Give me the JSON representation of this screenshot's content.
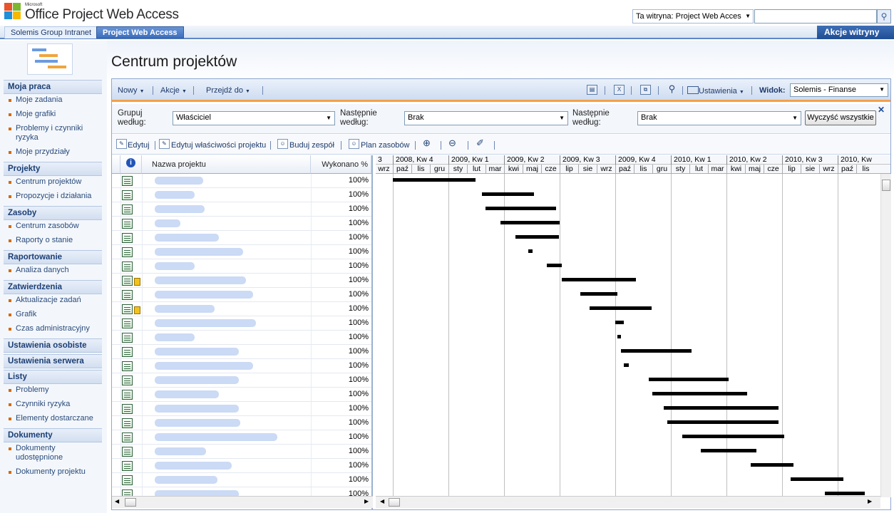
{
  "header": {
    "brand_small": "Microsoft",
    "brand": "Office Project Web Access",
    "search_scope": "Ta witryna: Project Web Acces",
    "search_value": "",
    "site_actions": "Akcje witryny"
  },
  "tabs": [
    {
      "label": "Solemis Group Intranet"
    },
    {
      "label": "Project Web Access"
    }
  ],
  "page": {
    "title": "Centrum projektów"
  },
  "nav": {
    "sections": [
      {
        "title": "Moja praca",
        "items": [
          "Moje zadania",
          "Moje grafiki",
          "Problemy i czynniki ryzyka",
          "Moje przydziały"
        ]
      },
      {
        "title": "Projekty",
        "items": [
          "Centrum projektów",
          "Propozycje i działania"
        ]
      },
      {
        "title": "Zasoby",
        "items": [
          "Centrum zasobów",
          "Raporty o stanie"
        ]
      },
      {
        "title": "Raportowanie",
        "items": [
          "Analiza danych"
        ]
      },
      {
        "title": "Zatwierdzenia",
        "items": [
          "Aktualizacje zadań",
          "Grafik",
          "Czas administracyjny"
        ]
      },
      {
        "title": "Ustawienia osobiste",
        "items": []
      },
      {
        "title": "Ustawienia serwera",
        "items": []
      },
      {
        "title": "Listy",
        "items": [
          "Problemy",
          "Czynniki ryzyka",
          "Elementy dostarczane"
        ]
      },
      {
        "title": "Dokumenty",
        "items": [
          "Dokumenty udostępnione",
          "Dokumenty projektu"
        ]
      }
    ]
  },
  "toolbar": {
    "new": "Nowy",
    "actions": "Akcje",
    "goto": "Przejdź do",
    "settings": "Ustawienia",
    "view_label": "Widok:",
    "view_value": "Solemis - Finanse"
  },
  "grouping": {
    "group_by_label": "Grupuj według:",
    "group_by_value": "Właściciel",
    "then_by_label_1": "Następnie według:",
    "then_by_value_1": "Brak",
    "then_by_label_2": "Następnie według:",
    "then_by_value_2": "Brak",
    "clear_all": "Wyczyść wszystkie"
  },
  "actions_bar": {
    "edit": "Edytuj",
    "edit_props": "Edytuj właściwości projektu",
    "build_team": "Buduj zespół",
    "resource_plan": "Plan zasobów"
  },
  "grid": {
    "headers": {
      "info": "i",
      "name": "Nazwa projektu",
      "percent": "Wykonano %"
    },
    "rows": [
      {
        "percent": "100%",
        "lock": false,
        "name_w": 68
      },
      {
        "percent": "100%",
        "lock": false,
        "name_w": 56
      },
      {
        "percent": "100%",
        "lock": false,
        "name_w": 70
      },
      {
        "percent": "100%",
        "lock": false,
        "name_w": 36
      },
      {
        "percent": "100%",
        "lock": false,
        "name_w": 90
      },
      {
        "percent": "100%",
        "lock": false,
        "name_w": 124
      },
      {
        "percent": "100%",
        "lock": false,
        "name_w": 56
      },
      {
        "percent": "100%",
        "lock": true,
        "name_w": 128
      },
      {
        "percent": "100%",
        "lock": false,
        "name_w": 138
      },
      {
        "percent": "100%",
        "lock": true,
        "name_w": 84
      },
      {
        "percent": "100%",
        "lock": false,
        "name_w": 142
      },
      {
        "percent": "100%",
        "lock": false,
        "name_w": 56
      },
      {
        "percent": "100%",
        "lock": false,
        "name_w": 118
      },
      {
        "percent": "100%",
        "lock": false,
        "name_w": 138
      },
      {
        "percent": "100%",
        "lock": false,
        "name_w": 118
      },
      {
        "percent": "100%",
        "lock": false,
        "name_w": 90
      },
      {
        "percent": "100%",
        "lock": false,
        "name_w": 118
      },
      {
        "percent": "100%",
        "lock": false,
        "name_w": 120
      },
      {
        "percent": "100%",
        "lock": false,
        "name_w": 172
      },
      {
        "percent": "100%",
        "lock": false,
        "name_w": 72
      },
      {
        "percent": "100%",
        "lock": false,
        "name_w": 108
      },
      {
        "percent": "100%",
        "lock": false,
        "name_w": 88
      },
      {
        "percent": "100%",
        "lock": false,
        "name_w": 118
      }
    ]
  },
  "gantt": {
    "quarters": [
      "3",
      "2008, Kw 4",
      "2009, Kw 1",
      "2009, Kw 2",
      "2009, Kw 3",
      "2009, Kw 4",
      "2010, Kw 1",
      "2010, Kw 2",
      "2010, Kw 3",
      "2010, Kw"
    ],
    "months": [
      "wrz",
      "paź",
      "lis",
      "gru",
      "sty",
      "lut",
      "mar",
      "kwi",
      "maj",
      "cze",
      "lip",
      "sie",
      "wrz",
      "paź",
      "lis",
      "gru",
      "sty",
      "lut",
      "mar",
      "kwi",
      "maj",
      "cze",
      "lip",
      "sie",
      "wrz",
      "paź",
      "lis"
    ],
    "bars": [
      {
        "start": "2008-10-01",
        "end": "2009-02-15"
      },
      {
        "start": "2009-02-25",
        "end": "2009-05-20"
      },
      {
        "start": "2009-03-01",
        "end": "2009-06-25"
      },
      {
        "start": "2009-03-25",
        "end": "2009-07-01"
      },
      {
        "start": "2009-04-20",
        "end": "2009-06-30"
      },
      {
        "start": "2009-05-10",
        "end": "2009-05-17"
      },
      {
        "start": "2009-06-10",
        "end": "2009-07-05"
      },
      {
        "start": "2009-07-05",
        "end": "2009-11-05"
      },
      {
        "start": "2009-08-05",
        "end": "2009-10-05"
      },
      {
        "start": "2009-08-20",
        "end": "2009-11-30"
      },
      {
        "start": "2009-10-01",
        "end": "2009-10-15"
      },
      {
        "start": "2009-10-05",
        "end": "2009-10-10"
      },
      {
        "start": "2009-10-10",
        "end": "2010-02-05"
      },
      {
        "start": "2009-10-15",
        "end": "2009-10-23"
      },
      {
        "start": "2009-11-25",
        "end": "2010-04-05"
      },
      {
        "start": "2009-12-01",
        "end": "2010-05-05"
      },
      {
        "start": "2009-12-20",
        "end": "2010-06-25"
      },
      {
        "start": "2009-12-25",
        "end": "2010-06-25"
      },
      {
        "start": "2010-01-20",
        "end": "2010-07-05"
      },
      {
        "start": "2010-02-20",
        "end": "2010-05-20"
      },
      {
        "start": "2010-05-10",
        "end": "2010-07-20"
      },
      {
        "start": "2010-07-15",
        "end": "2010-10-10"
      },
      {
        "start": "2010-09-10",
        "end": "2010-11-15"
      }
    ]
  }
}
